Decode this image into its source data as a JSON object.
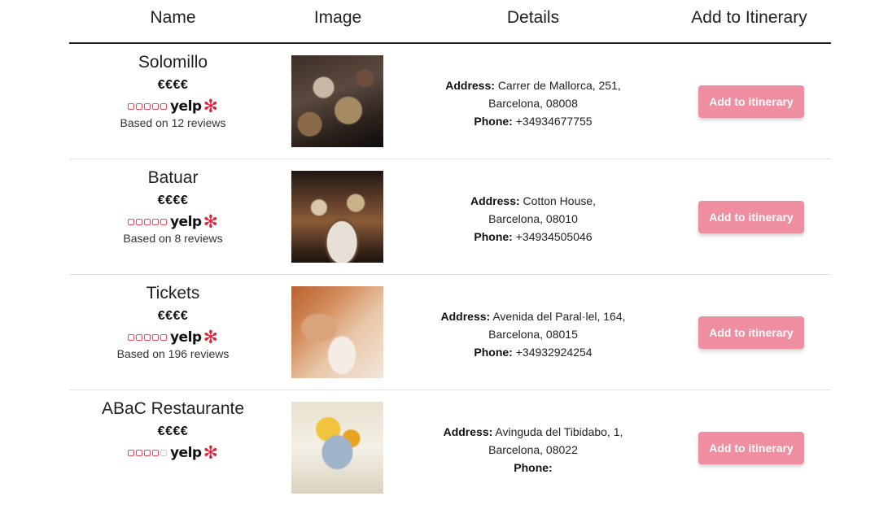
{
  "headers": {
    "name": "Name",
    "image": "Image",
    "details": "Details",
    "add": "Add to Itinerary"
  },
  "labels": {
    "address": "Address:",
    "phone": "Phone:",
    "yelp": "yelp",
    "add_button": "Add to itinerary"
  },
  "colors": {
    "button_bg": "#ef8ea0",
    "yelp_red": "#e8213a"
  },
  "restaurants": [
    {
      "name": "Solomillo",
      "price": "€€€€",
      "rating_stars_filled": 5,
      "reviews": "Based on 12 reviews",
      "address_line1": "Carrer de Mallorca, 251,",
      "address_line2": "Barcelona, 08008",
      "phone": "+34934677755"
    },
    {
      "name": "Batuar",
      "price": "€€€€",
      "rating_stars_filled": 5,
      "reviews": "Based on 8 reviews",
      "address_line1": "Cotton House,",
      "address_line2": "Barcelona, 08010",
      "phone": "+34934505046"
    },
    {
      "name": "Tickets",
      "price": "€€€€",
      "rating_stars_filled": 5,
      "reviews": "Based on 196 reviews",
      "address_line1": "Avenida del Paral·lel, 164,",
      "address_line2": "Barcelona, 08015",
      "phone": "+34932924254"
    },
    {
      "name": "ABaC Restaurante",
      "price": "€€€€",
      "rating_stars_filled": 4,
      "reviews": "",
      "address_line1": "Avinguda del Tibidabo, 1,",
      "address_line2": "Barcelona, 08022",
      "phone": ""
    }
  ]
}
